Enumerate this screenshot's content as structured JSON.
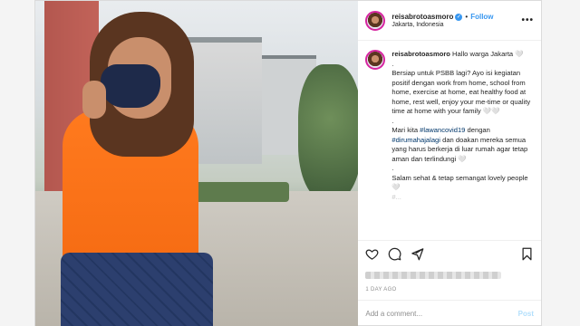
{
  "header": {
    "username": "reisabrotoasmoro",
    "separator": "•",
    "follow_label": "Follow",
    "location": "Jakarta, Indonesia",
    "more_label": "•••",
    "verified_glyph": "✓"
  },
  "caption": {
    "username": "reisabrotoasmoro",
    "greeting": " Hallo warga Jakarta 🤍",
    "dot1": ".",
    "para1": "Bersiap untuk PSBB lagi? Ayo isi kegiatan positif dengan work from home, school from home, exercise at home, eat healthy food at home, rest well, enjoy your me-time or quality time at home with your family 🤍🤍",
    "dot2": ".",
    "para2_prefix": "Mari kita ",
    "para2_tag1": "#lawancovid19",
    "para2_mid": " dengan ",
    "para2_tag2": "#dirumahajalagi",
    "para2_suffix": " dan doakan mereka semua yang harus berkerja di luar rumah agar tetap aman dan terlindungi 🤍",
    "dot3": ".",
    "para3": "Salam sehat & tetap semangat lovely people 🤍",
    "faded": "#..."
  },
  "actions": {
    "icons": [
      "heart-icon",
      "comment-icon",
      "share-icon",
      "bookmark-icon"
    ]
  },
  "meta": {
    "date": "1 DAY AGO"
  },
  "comment_box": {
    "placeholder": "Add a comment...",
    "post_label": "Post"
  },
  "colors": {
    "accent": "#3897f0",
    "post_disabled": "#b2dffc",
    "hashtag": "#00376b"
  }
}
